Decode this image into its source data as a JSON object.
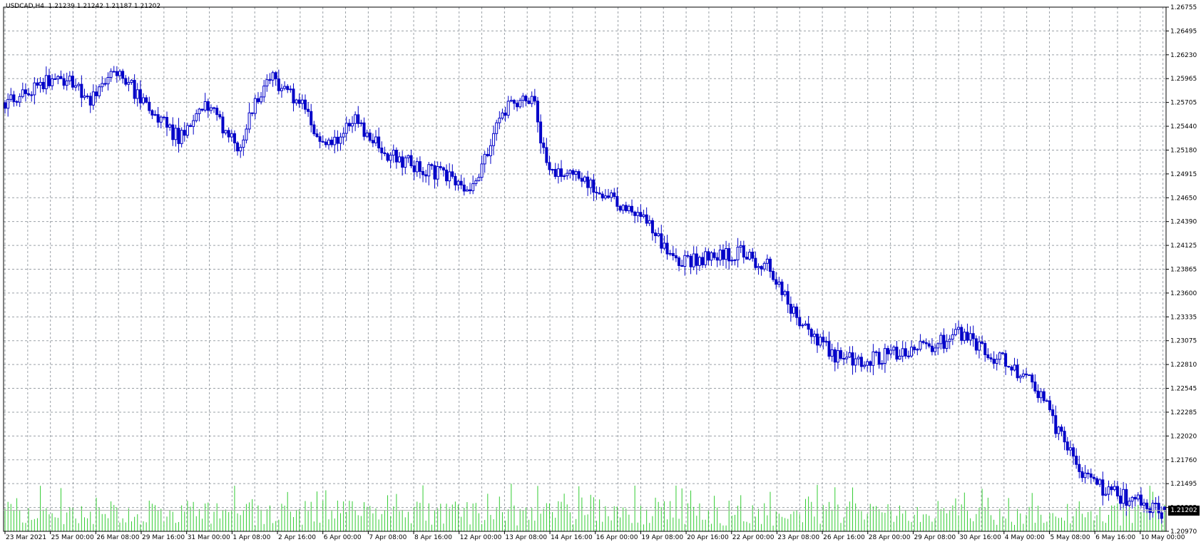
{
  "chart_title": "USDCAD,H4  1.21239 1.21242 1.21187 1.21202",
  "current_price": "1.21202",
  "colors": {
    "background": "#ffffff",
    "grid": "#9aa0a6",
    "candle": "#0000c8",
    "volume": "#33cc33",
    "axis": "#000000",
    "price_line": "#b0b0b0"
  },
  "chart_data": {
    "type": "candlestick",
    "symbol": "USDCAD",
    "timeframe": "H4",
    "last_bar": {
      "open": 1.21239,
      "high": 1.21242,
      "low": 1.21187,
      "close": 1.21202
    },
    "ylim": [
      1.2097,
      1.26755
    ],
    "y_ticks": [
      "1.26755",
      "1.26495",
      "1.26230",
      "1.25965",
      "1.25705",
      "1.25440",
      "1.25180",
      "1.24915",
      "1.24650",
      "1.24390",
      "1.24125",
      "1.23865",
      "1.23600",
      "1.23335",
      "1.23075",
      "1.22810",
      "1.22545",
      "1.22285",
      "1.22020",
      "1.21760",
      "1.21495",
      "1.21235",
      "1.20970"
    ],
    "x_ticks": [
      "23 Mar 2021",
      "25 Mar 00:00",
      "26 Mar 08:00",
      "29 Mar 16:00",
      "31 Mar 00:00",
      "1 Apr 08:00",
      "2 Apr 16:00",
      "6 Apr 00:00",
      "7 Apr 08:00",
      "8 Apr 16:00",
      "12 Apr 00:00",
      "13 Apr 08:00",
      "14 Apr 16:00",
      "16 Apr 00:00",
      "19 Apr 08:00",
      "20 Apr 16:00",
      "22 Apr 00:00",
      "23 Apr 08:00",
      "26 Apr 16:00",
      "28 Apr 00:00",
      "29 Apr 08:00",
      "30 Apr 16:00",
      "4 May 00:00",
      "5 May 08:00",
      "6 May 16:00",
      "10 May 00:00"
    ],
    "grid": true,
    "volume_bars": true,
    "anchors": [
      [
        0,
        1.257
      ],
      [
        10,
        1.2585
      ],
      [
        20,
        1.26
      ],
      [
        30,
        1.2575
      ],
      [
        40,
        1.2605
      ],
      [
        50,
        1.256
      ],
      [
        60,
        1.253
      ],
      [
        70,
        1.257
      ],
      [
        80,
        1.252
      ],
      [
        90,
        1.26
      ],
      [
        100,
        1.2575
      ],
      [
        110,
        1.252
      ],
      [
        120,
        1.255
      ],
      [
        130,
        1.2515
      ],
      [
        140,
        1.25
      ],
      [
        150,
        1.249
      ],
      [
        160,
        1.2475
      ],
      [
        170,
        1.256
      ],
      [
        180,
        1.258
      ],
      [
        185,
        1.25
      ],
      [
        200,
        1.248
      ],
      [
        215,
        1.245
      ],
      [
        230,
        1.2395
      ],
      [
        250,
        1.2405
      ],
      [
        260,
        1.239
      ],
      [
        270,
        1.233
      ],
      [
        285,
        1.2285
      ],
      [
        300,
        1.229
      ],
      [
        315,
        1.23
      ],
      [
        325,
        1.2315
      ],
      [
        340,
        1.2285
      ],
      [
        350,
        1.2265
      ],
      [
        360,
        1.22
      ],
      [
        370,
        1.215
      ],
      [
        385,
        1.213
      ],
      [
        394,
        1.212
      ]
    ]
  }
}
